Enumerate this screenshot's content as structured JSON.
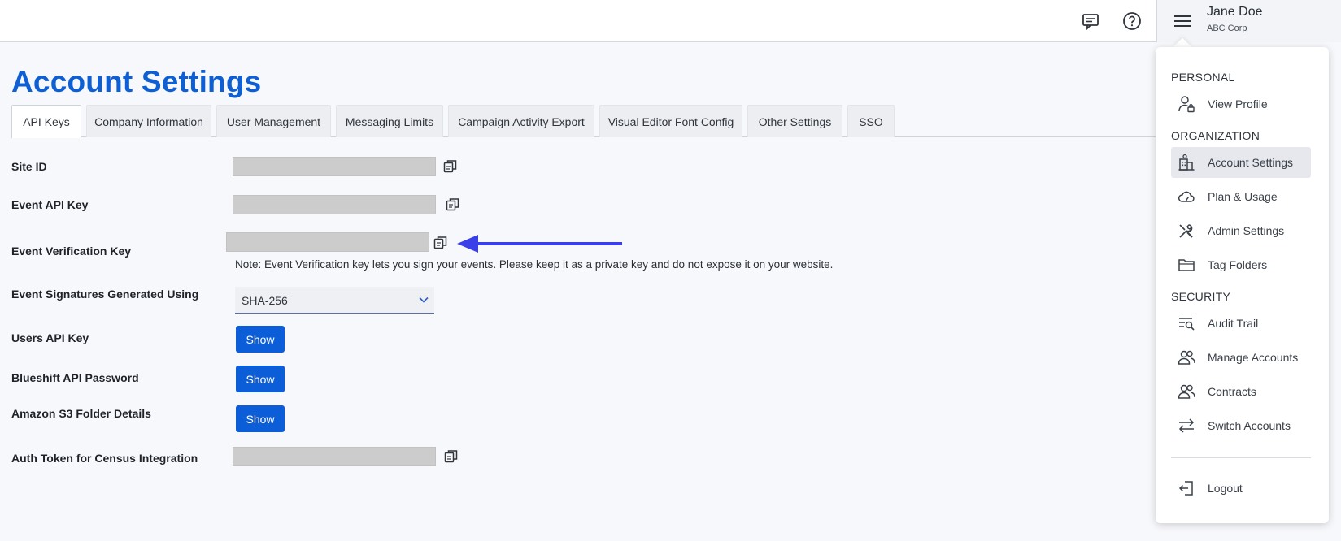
{
  "header": {
    "user_name": "Jane Doe",
    "user_org": "ABC Corp",
    "icons": [
      "chat-icon",
      "help-icon",
      "hamburger-menu-icon"
    ]
  },
  "page": {
    "title": "Account Settings"
  },
  "tabs": [
    {
      "label": "API Keys",
      "active": true
    },
    {
      "label": "Company Information",
      "active": false
    },
    {
      "label": "User Management",
      "active": false
    },
    {
      "label": "Messaging Limits",
      "active": false
    },
    {
      "label": "Campaign Activity Export",
      "active": false
    },
    {
      "label": "Visual Editor Font Config",
      "active": false
    },
    {
      "label": "Other Settings",
      "active": false
    },
    {
      "label": "SSO",
      "active": false
    }
  ],
  "fields": {
    "site_id": "Site ID",
    "event_api_key": "Event API Key",
    "event_verification_key": "Event Verification Key",
    "event_verification_note": "Note: Event Verification key lets you sign your events. Please keep it as a private key and do not expose it on your website.",
    "event_signatures": "Event Signatures Generated Using",
    "event_signatures_value": "SHA-256",
    "users_api_key": "Users API Key",
    "blueshift_api_password": "Blueshift API Password",
    "amazon_s3": "Amazon S3 Folder Details",
    "auth_token": "Auth Token for Census Integration",
    "show_label": "Show"
  },
  "menu": {
    "sections": {
      "personal": "PERSONAL",
      "organization": "ORGANIZATION",
      "security": "SECURITY"
    },
    "items": {
      "view_profile": "View Profile",
      "account_settings": "Account Settings",
      "plan_usage": "Plan & Usage",
      "admin_settings": "Admin Settings",
      "tag_folders": "Tag Folders",
      "audit_trail": "Audit Trail",
      "manage_accounts": "Manage Accounts",
      "contracts": "Contracts",
      "switch_accounts": "Switch Accounts",
      "logout": "Logout"
    },
    "active_item": "Account Settings"
  },
  "colors": {
    "accent": "#0d5fd3",
    "button": "#0b5ed7",
    "annotation_arrow": "#3b3fe8",
    "masked_value": "#cccccc"
  }
}
